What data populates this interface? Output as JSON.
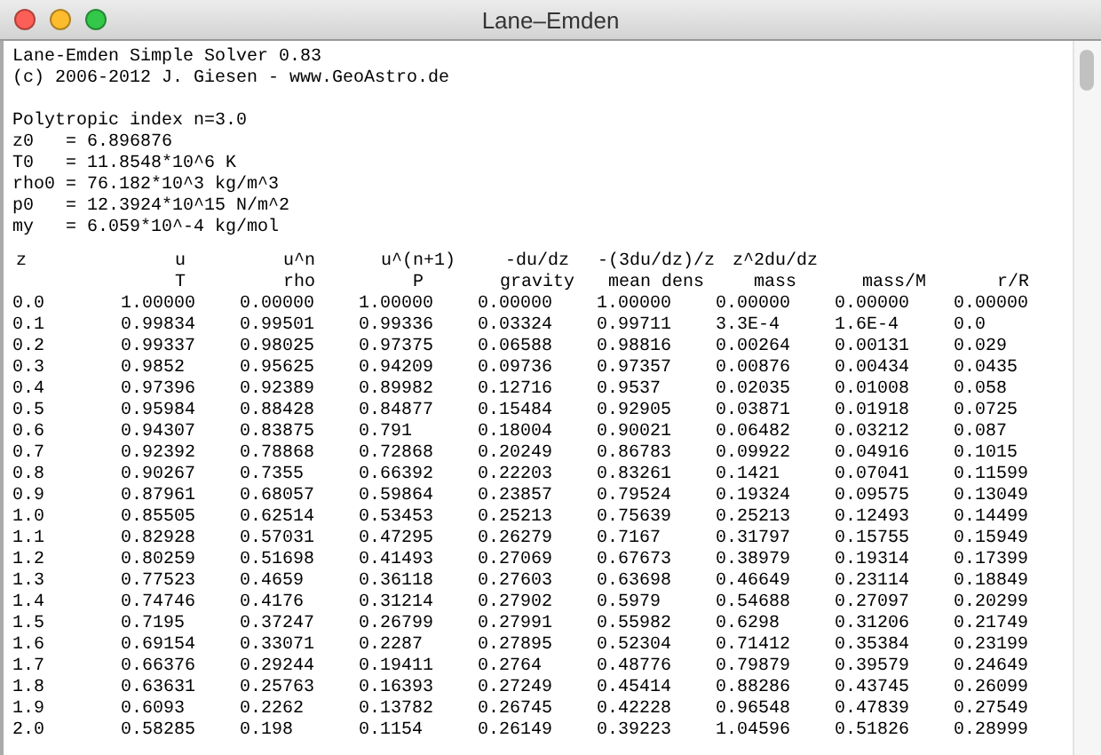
{
  "window": {
    "title": "Lane–Emden"
  },
  "header_blocks": [
    [
      "Lane-Emden Simple Solver 0.83",
      "(c) 2006-2012 J. Giesen - www.GeoAstro.de"
    ],
    [
      "Polytropic index n=3.0",
      "z0   = 6.896876",
      "T0   = 11.8548*10^6 K",
      "rho0 = 76.182*10^3 kg/m^3",
      "p0   = 12.3924*10^15 N/m^2",
      "my   = 6.059*10^-4 kg/mol"
    ]
  ],
  "table": {
    "columns": [
      {
        "label": "z"
      },
      {
        "label": "u",
        "sublabel": "T"
      },
      {
        "label": "u^n",
        "sublabel": "rho"
      },
      {
        "label": "u^(n+1)",
        "sublabel": "P"
      },
      {
        "label": "-du/dz",
        "sublabel": "gravity"
      },
      {
        "label": "-(3du/dz)/z",
        "sublabel": "mean dens"
      },
      {
        "label": "z^2du/dz",
        "sublabel": "mass"
      },
      {
        "sublabel": "mass/M"
      },
      {
        "sublabel": "r/R"
      }
    ],
    "rows": [
      [
        "0.0",
        "1.00000",
        "0.00000",
        "1.00000",
        "0.00000",
        "1.00000",
        "0.00000",
        "0.00000",
        "0.00000"
      ],
      [
        "0.1",
        "0.99834",
        "0.99501",
        "0.99336",
        "0.03324",
        "0.99711",
        "3.3E-4",
        "1.6E-4",
        "0.0"
      ],
      [
        "0.2",
        "0.99337",
        "0.98025",
        "0.97375",
        "0.06588",
        "0.98816",
        "0.00264",
        "0.00131",
        "0.029"
      ],
      [
        "0.3",
        "0.9852",
        "0.95625",
        "0.94209",
        "0.09736",
        "0.97357",
        "0.00876",
        "0.00434",
        "0.0435"
      ],
      [
        "0.4",
        "0.97396",
        "0.92389",
        "0.89982",
        "0.12716",
        "0.9537",
        "0.02035",
        "0.01008",
        "0.058"
      ],
      [
        "0.5",
        "0.95984",
        "0.88428",
        "0.84877",
        "0.15484",
        "0.92905",
        "0.03871",
        "0.01918",
        "0.0725"
      ],
      [
        "0.6",
        "0.94307",
        "0.83875",
        "0.791",
        "0.18004",
        "0.90021",
        "0.06482",
        "0.03212",
        "0.087"
      ],
      [
        "0.7",
        "0.92392",
        "0.78868",
        "0.72868",
        "0.20249",
        "0.86783",
        "0.09922",
        "0.04916",
        "0.1015"
      ],
      [
        "0.8",
        "0.90267",
        "0.7355",
        "0.66392",
        "0.22203",
        "0.83261",
        "0.1421",
        "0.07041",
        "0.11599"
      ],
      [
        "0.9",
        "0.87961",
        "0.68057",
        "0.59864",
        "0.23857",
        "0.79524",
        "0.19324",
        "0.09575",
        "0.13049"
      ],
      [
        "1.0",
        "0.85505",
        "0.62514",
        "0.53453",
        "0.25213",
        "0.75639",
        "0.25213",
        "0.12493",
        "0.14499"
      ],
      [
        "1.1",
        "0.82928",
        "0.57031",
        "0.47295",
        "0.26279",
        "0.7167",
        "0.31797",
        "0.15755",
        "0.15949"
      ],
      [
        "1.2",
        "0.80259",
        "0.51698",
        "0.41493",
        "0.27069",
        "0.67673",
        "0.38979",
        "0.19314",
        "0.17399"
      ],
      [
        "1.3",
        "0.77523",
        "0.4659",
        "0.36118",
        "0.27603",
        "0.63698",
        "0.46649",
        "0.23114",
        "0.18849"
      ],
      [
        "1.4",
        "0.74746",
        "0.4176",
        "0.31214",
        "0.27902",
        "0.5979",
        "0.54688",
        "0.27097",
        "0.20299"
      ],
      [
        "1.5",
        "0.7195",
        "0.37247",
        "0.26799",
        "0.27991",
        "0.55982",
        "0.6298",
        "0.31206",
        "0.21749"
      ],
      [
        "1.6",
        "0.69154",
        "0.33071",
        "0.2287",
        "0.27895",
        "0.52304",
        "0.71412",
        "0.35384",
        "0.23199"
      ],
      [
        "1.7",
        "0.66376",
        "0.29244",
        "0.19411",
        "0.2764",
        "0.48776",
        "0.79879",
        "0.39579",
        "0.24649"
      ],
      [
        "1.8",
        "0.63631",
        "0.25763",
        "0.16393",
        "0.27249",
        "0.45414",
        "0.88286",
        "0.43745",
        "0.26099"
      ],
      [
        "1.9",
        "0.6093",
        "0.2262",
        "0.13782",
        "0.26745",
        "0.42228",
        "0.96548",
        "0.47839",
        "0.27549"
      ],
      [
        "2.0",
        "0.58285",
        "0.198",
        "0.1154",
        "0.26149",
        "0.39223",
        "1.04596",
        "0.51826",
        "0.28999"
      ]
    ]
  }
}
